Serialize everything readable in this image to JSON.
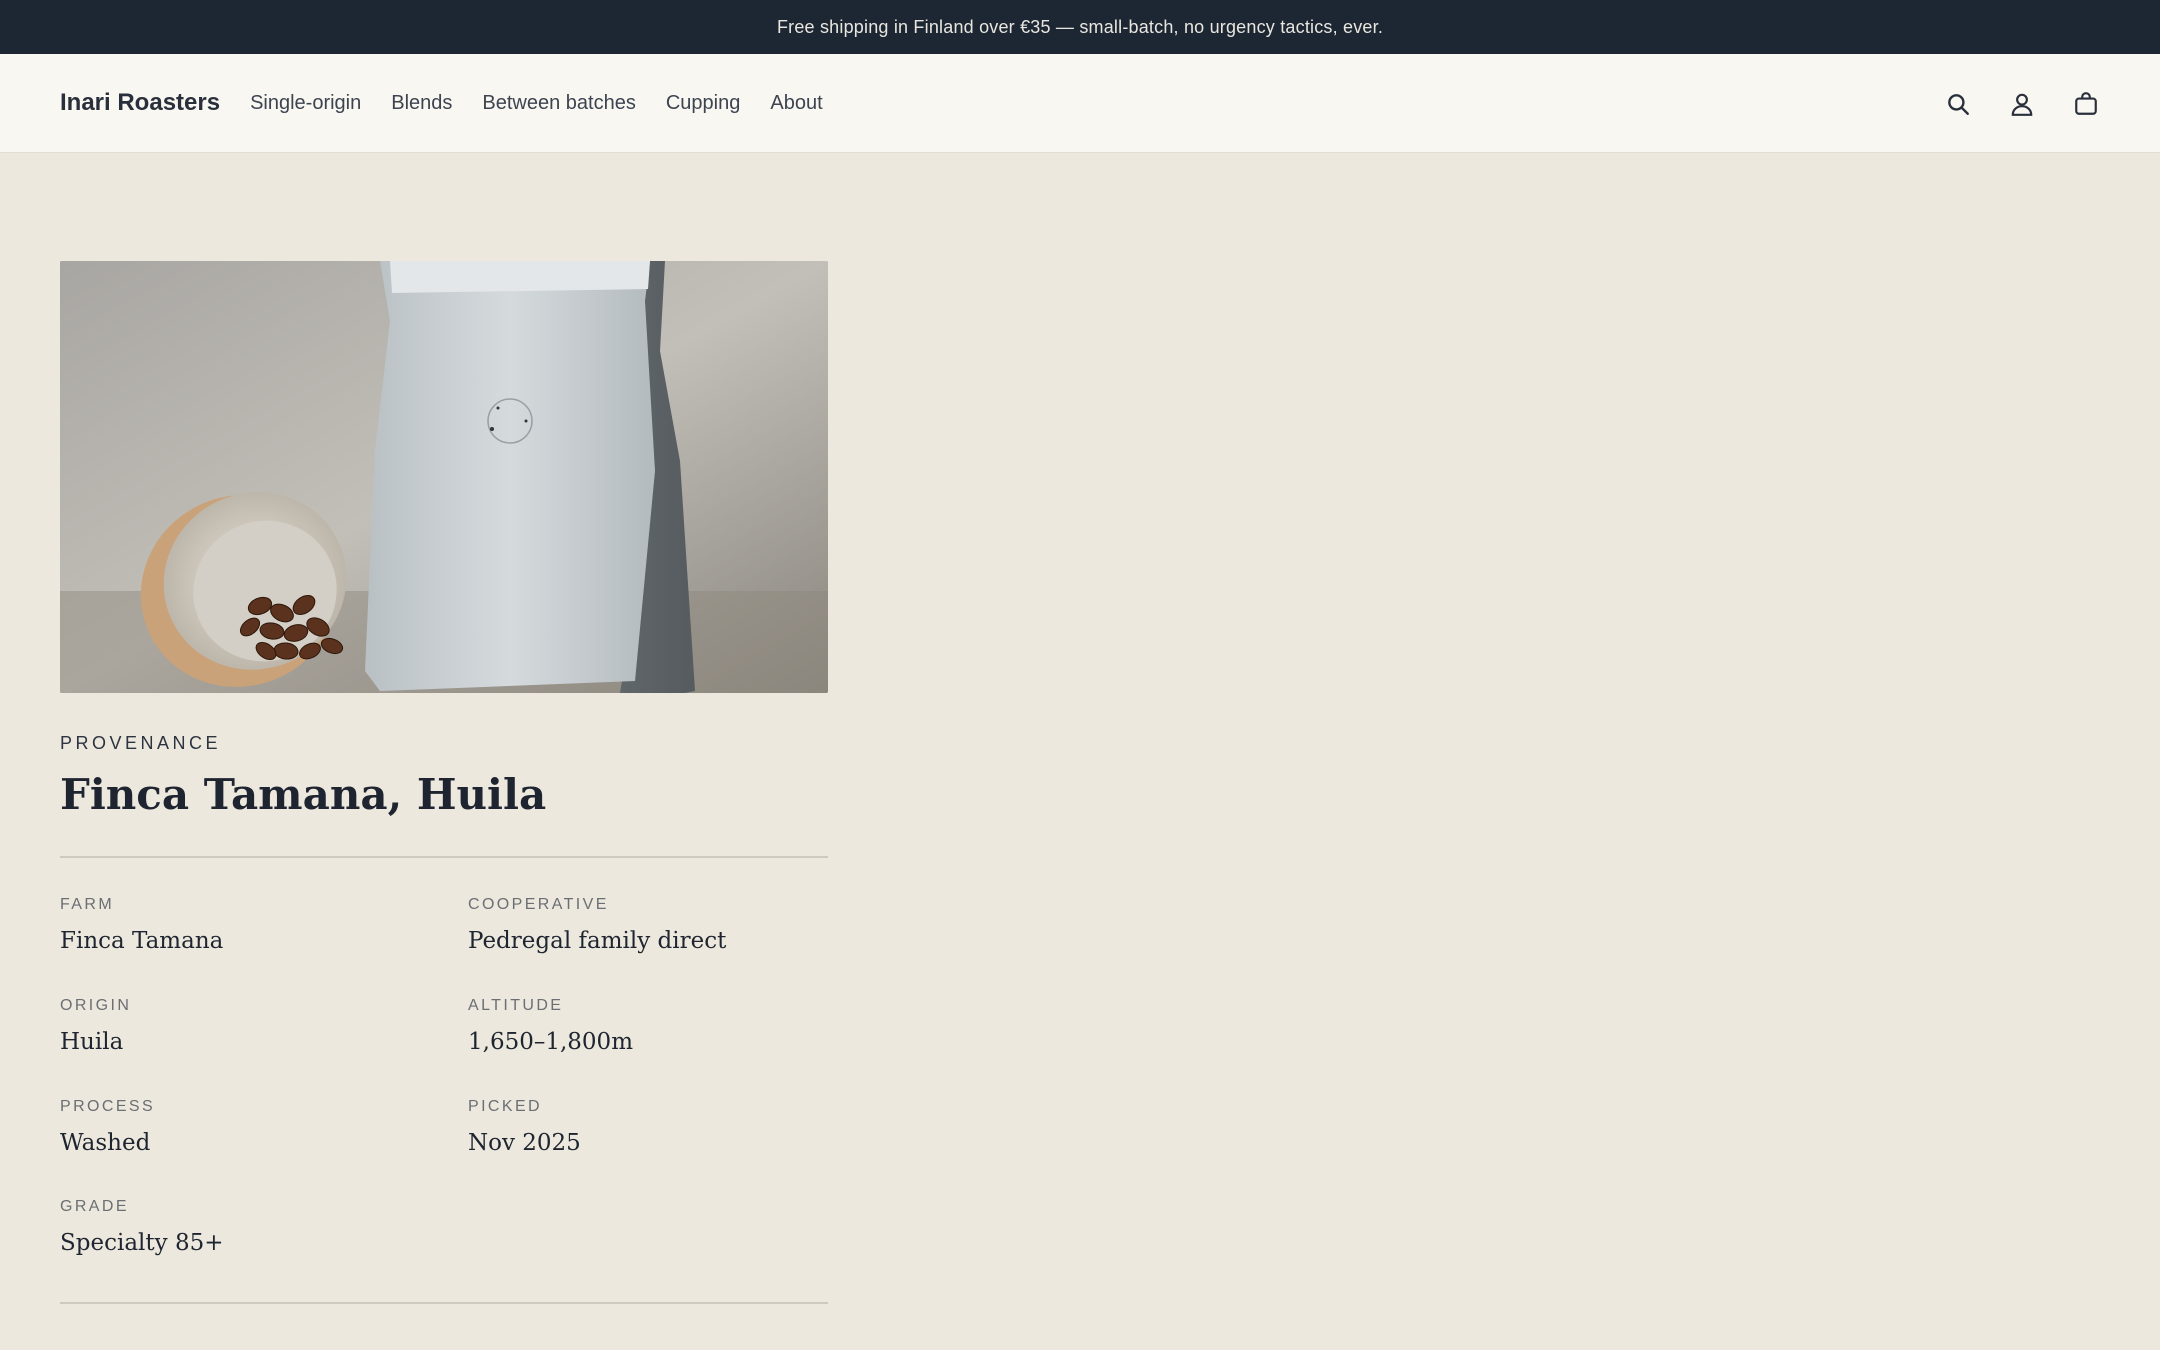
{
  "announcement": "Free shipping in Finland over €35 — small-batch, no urgency tactics, ever.",
  "header": {
    "brand": "Inari Roasters",
    "nav": [
      {
        "label": "Single-origin"
      },
      {
        "label": "Blends"
      },
      {
        "label": "Between batches"
      },
      {
        "label": "Cupping"
      },
      {
        "label": "About"
      }
    ],
    "icons": [
      "search-icon",
      "account-icon",
      "cart-icon"
    ]
  },
  "product": {
    "image_description_icon": "coffee-bag-photo",
    "eyebrow": "PROVENANCE",
    "title": "Finca Tamana, Huila",
    "specs": [
      {
        "label": "FARM",
        "value": "Finca Tamana"
      },
      {
        "label": "COOPERATIVE",
        "value": "Pedregal family direct"
      },
      {
        "label": "ORIGIN",
        "value": "Huila"
      },
      {
        "label": "ALTITUDE",
        "value": "1,650–1,800m"
      },
      {
        "label": "PROCESS",
        "value": "Washed"
      },
      {
        "label": "PICKED",
        "value": "Nov 2025"
      },
      {
        "label": "GRADE",
        "value": "Specialty 85+"
      }
    ]
  },
  "colors": {
    "page_bg": "#ece8dd",
    "announce_bg": "#1d2633",
    "header_bg": "#f8f7f2",
    "text": "#1f2530"
  }
}
